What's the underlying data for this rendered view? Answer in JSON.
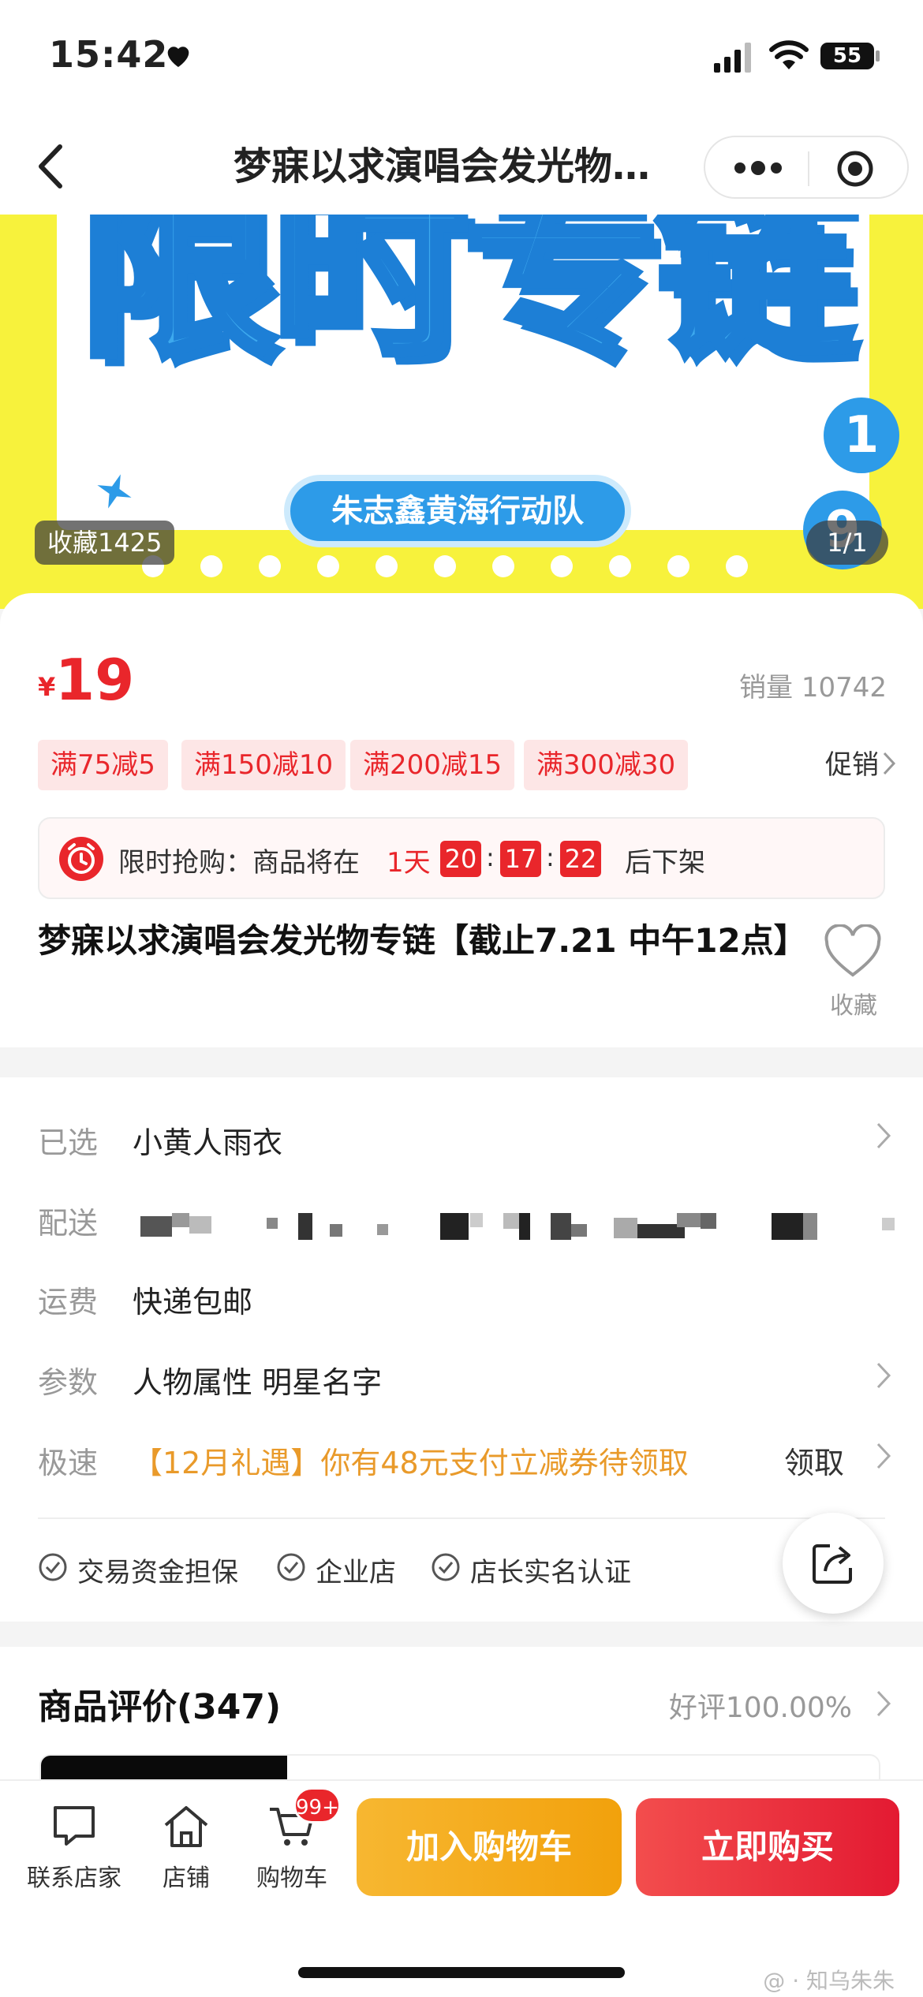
{
  "status_bar": {
    "time": "15:42",
    "battery": "55"
  },
  "nav": {
    "title": "梦寐以求演唱会发光物…"
  },
  "banner": {
    "headline": "限时专链",
    "tag": "朱志鑫黄海行动队",
    "badge_one": "1",
    "badge_nine": "9",
    "favorites": "收藏1425",
    "page_indicator": "1/1",
    "colors": {
      "background": "#f7f23c",
      "accent": "#2d9be8"
    }
  },
  "product": {
    "currency": "¥",
    "price": "19",
    "sales": "销量 10742",
    "coupons": [
      "满75减5",
      "满150减10",
      "满200减15",
      "满300减30"
    ],
    "promo_label": "促销",
    "flash": {
      "label": "限时抢购：商品将在",
      "days": "1天",
      "hours": "20",
      "minutes": "17",
      "seconds": "22",
      "after": "后下架"
    },
    "title": "梦寐以求演唱会发光物专链【截止7.21 中午12点】",
    "favorite_label": "收藏"
  },
  "details": {
    "selected_label": "已选",
    "selected_value": "小黄人雨衣",
    "delivery_label": "配送",
    "shipping_label": "运费",
    "shipping_value": "快递包邮",
    "params_label": "参数",
    "params_value": "人物属性 明星名字",
    "express_label": "极速",
    "express_value": "【12月礼遇】你有48元支付立减券待领取",
    "claim_label": "领取",
    "guarantees": [
      "交易资金担保",
      "企业店",
      "店长实名认证"
    ]
  },
  "reviews": {
    "title": "商品评价(347)",
    "rate": "好评100.00%"
  },
  "bottom_bar": {
    "tabs": [
      "联系店家",
      "店铺",
      "购物车"
    ],
    "cart_badge": "99+",
    "add_to_cart": "加入购物车",
    "buy_now": "立即购买",
    "colors": {
      "cart": "#f2a10c",
      "buy": "#e31a32"
    }
  },
  "watermark": "@ · 知乌朱朱"
}
